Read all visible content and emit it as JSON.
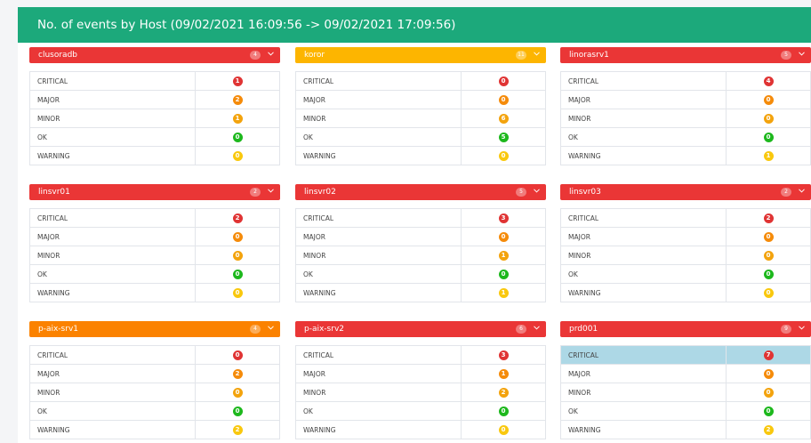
{
  "header": {
    "title": "No. of events by Host (09/02/2021 16:09:56 -> 09/02/2021 17:09:56)"
  },
  "colors": {
    "header": "#1ca97b",
    "red": "#ea3636",
    "amber": "#fdb500",
    "orange": "#fb8200",
    "ok": "#1db81d",
    "warning": "#f9c80e",
    "minor": "#f3a30d",
    "major": "#f58b0a",
    "critical": "#e03434",
    "highlight": "#add8e6"
  },
  "severity_labels": [
    "CRITICAL",
    "MAJOR",
    "MINOR",
    "OK",
    "WARNING"
  ],
  "hosts": [
    {
      "name": "clusoradb",
      "count": "4",
      "color": "red",
      "values": [
        "1",
        "2",
        "1",
        "0",
        "0"
      ]
    },
    {
      "name": "koror",
      "count": "11",
      "color": "amber",
      "values": [
        "0",
        "0",
        "6",
        "5",
        "0"
      ]
    },
    {
      "name": "linorasrv1",
      "count": "5",
      "color": "red",
      "values": [
        "4",
        "0",
        "0",
        "0",
        "1"
      ]
    },
    {
      "name": "linsvr01",
      "count": "2",
      "color": "red",
      "values": [
        "2",
        "0",
        "0",
        "0",
        "0"
      ]
    },
    {
      "name": "linsvr02",
      "count": "5",
      "color": "red",
      "values": [
        "3",
        "0",
        "1",
        "0",
        "1"
      ]
    },
    {
      "name": "linsvr03",
      "count": "2",
      "color": "red",
      "values": [
        "2",
        "0",
        "0",
        "0",
        "0"
      ]
    },
    {
      "name": "p-aix-srv1",
      "count": "4",
      "color": "orange",
      "values": [
        "0",
        "2",
        "0",
        "0",
        "2"
      ]
    },
    {
      "name": "p-aix-srv2",
      "count": "6",
      "color": "red",
      "values": [
        "3",
        "1",
        "2",
        "0",
        "0"
      ]
    },
    {
      "name": "prd001",
      "count": "9",
      "color": "red",
      "values": [
        "7",
        "0",
        "0",
        "0",
        "2"
      ],
      "highlighted_row": "CRITICAL"
    }
  ]
}
